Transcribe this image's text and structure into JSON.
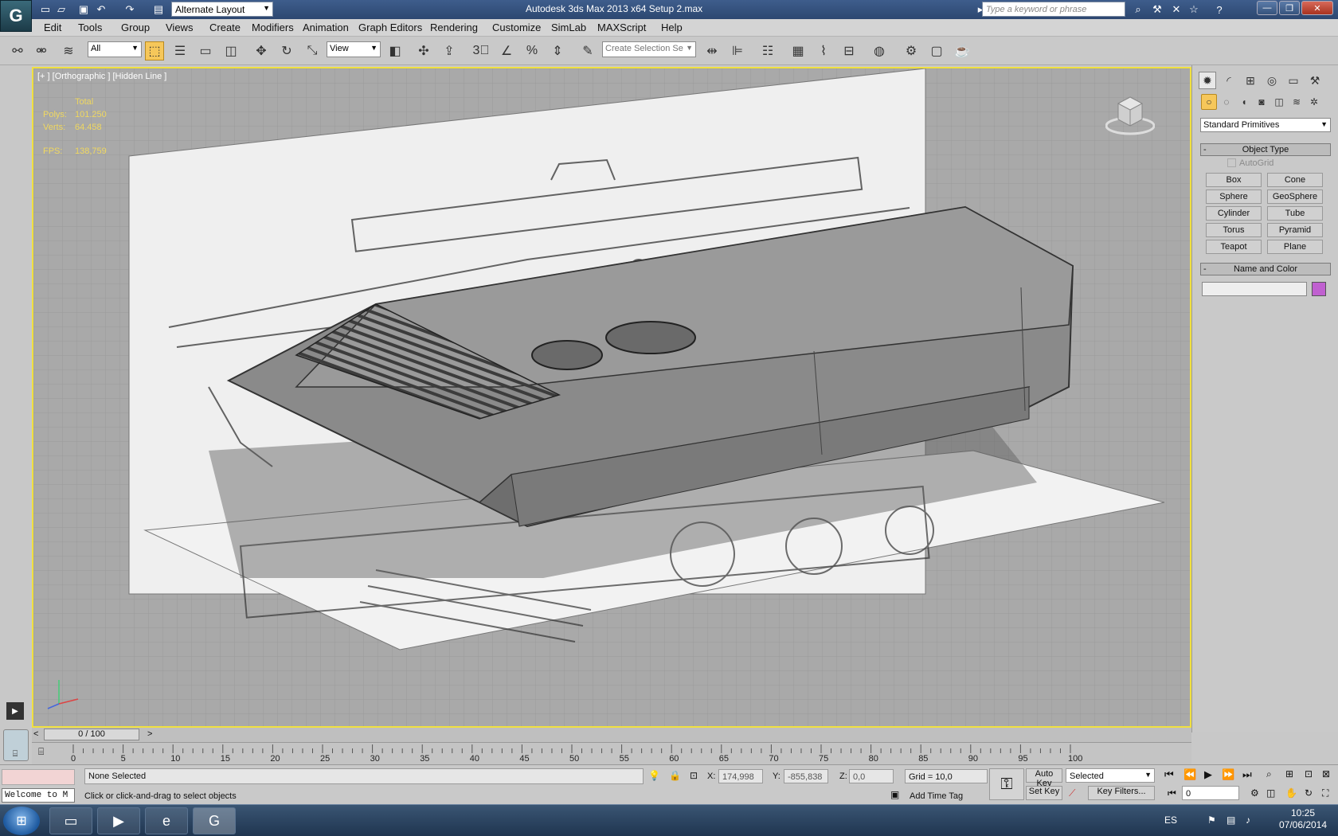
{
  "titlebar": {
    "workspace": "Alternate Layout",
    "title": "Autodesk 3ds Max  2013 x64      Setup 2.max",
    "search_placeholder": "Type a keyword or phrase"
  },
  "menu": [
    "Edit",
    "Tools",
    "Group",
    "Views",
    "Create",
    "Modifiers",
    "Animation",
    "Graph Editors",
    "Rendering",
    "Customize",
    "SimLab",
    "MAXScript",
    "Help"
  ],
  "toolbar": {
    "selection_filter": "All",
    "ref_coord": "View",
    "named_selection_placeholder": "Create Selection Se"
  },
  "viewport": {
    "label": "[+ ] [Orthographic ] [Hidden Line ]",
    "stats_header": "Total",
    "polys_label": "Polys:",
    "polys_value": "101.250",
    "verts_label": "Verts:",
    "verts_value": "64.458",
    "fps_label": "FPS:",
    "fps_value": "138,759"
  },
  "command_panel": {
    "category": "Standard Primitives",
    "object_type_title": "Object Type",
    "autogrid_label": "AutoGrid",
    "primitives": [
      "Box",
      "Cone",
      "Sphere",
      "GeoSphere",
      "Cylinder",
      "Tube",
      "Torus",
      "Pyramid",
      "Teapot",
      "Plane"
    ],
    "name_color_title": "Name and Color",
    "object_color": "#c060d0"
  },
  "timeline": {
    "frame_display": "0 / 100",
    "ticks": [
      "0",
      "5",
      "10",
      "15",
      "20",
      "25",
      "30",
      "35",
      "40",
      "45",
      "50",
      "55",
      "60",
      "65",
      "70",
      "75",
      "80",
      "85",
      "90",
      "95",
      "100"
    ]
  },
  "status": {
    "selection": "None Selected",
    "prompt": "Click or click-and-drag to select objects",
    "x_label": "X:",
    "x_value": "174,998",
    "y_label": "Y:",
    "y_value": "-855,838",
    "z_label": "Z:",
    "z_value": "0,0",
    "grid": "Grid = 10,0",
    "add_time_tag": "Add Time Tag",
    "auto_key": "Auto Key",
    "set_key": "Set Key",
    "key_mode": "Selected",
    "key_filters": "Key Filters...",
    "current_frame": "0",
    "maxscript": "Welcome to M"
  },
  "taskbar": {
    "language": "ES",
    "time": "10:25",
    "date": "07/06/2014"
  }
}
